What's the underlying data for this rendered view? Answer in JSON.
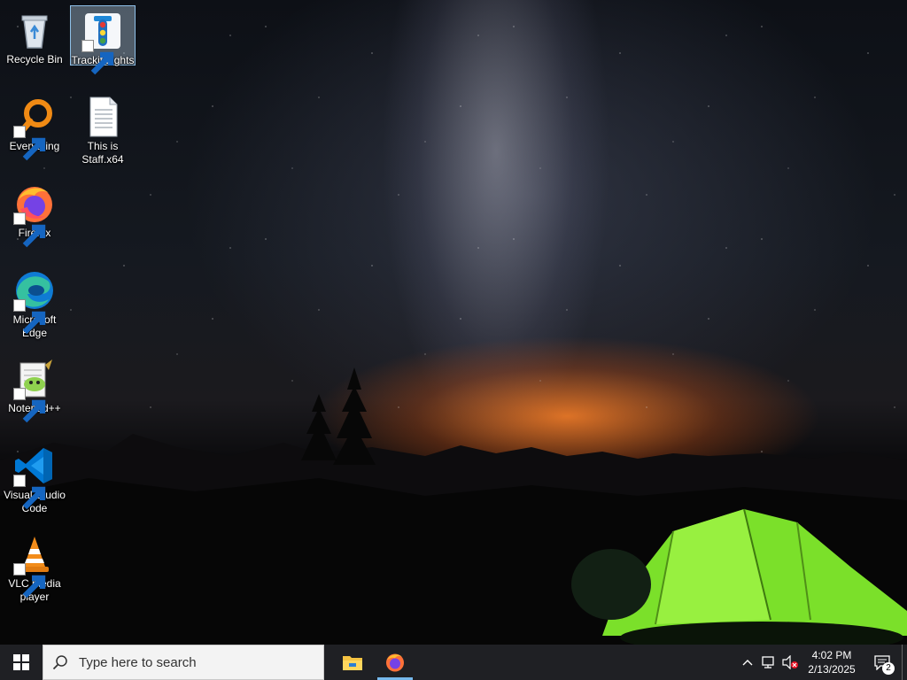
{
  "desktop_icons": {
    "recycle_bin": "Recycle Bin",
    "trackit_lights": "Trackit Lights",
    "everything": "Everything",
    "this_is_staff": "This is Staff.x64",
    "firefox": "Firefox",
    "edge": "Microsoft Edge",
    "notepadpp": "Notepad++",
    "vscode": "Visual Studio Code",
    "vlc": "VLC media player"
  },
  "taskbar": {
    "search_placeholder": "Type here to search",
    "pinned": [
      "file-explorer-icon",
      "firefox-icon"
    ]
  },
  "tray": {
    "time": "4:02 PM",
    "date": "2/13/2025",
    "notification_count": "2"
  },
  "colors": {
    "taskbar": "#1f2024",
    "search_bg": "#f3f3f3",
    "active_indicator": "#76b9ed"
  }
}
